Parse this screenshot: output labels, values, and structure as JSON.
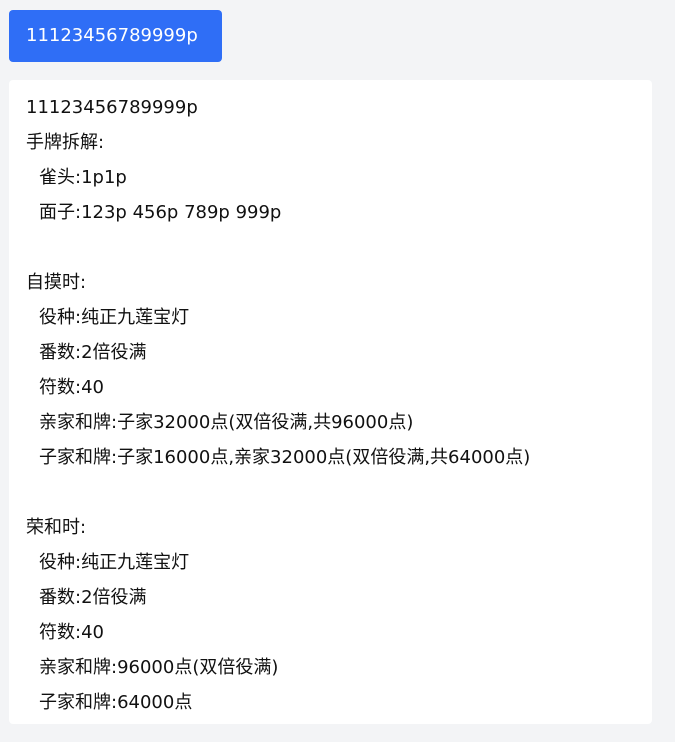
{
  "hand_button": {
    "label": "11123456789999p"
  },
  "result": {
    "hand": "11123456789999p",
    "decomposition_title": "手牌拆解:",
    "pair": "雀头:1p1p",
    "melds": "面子:123p 456p 789p 999p",
    "tsumo": {
      "title": "自摸时:",
      "yaku": "役种:纯正九莲宝灯",
      "han": "番数:2倍役满",
      "fu": "符数:40",
      "dealer": "亲家和牌:子家32000点(双倍役满,共96000点)",
      "nondealer": "子家和牌:子家16000点,亲家32000点(双倍役满,共64000点)"
    },
    "ron": {
      "title": "荣和时:",
      "yaku": "役种:纯正九莲宝灯",
      "han": "番数:2倍役满",
      "fu": "符数:40",
      "dealer": "亲家和牌:96000点(双倍役满)",
      "nondealer": "子家和牌:64000点"
    }
  }
}
